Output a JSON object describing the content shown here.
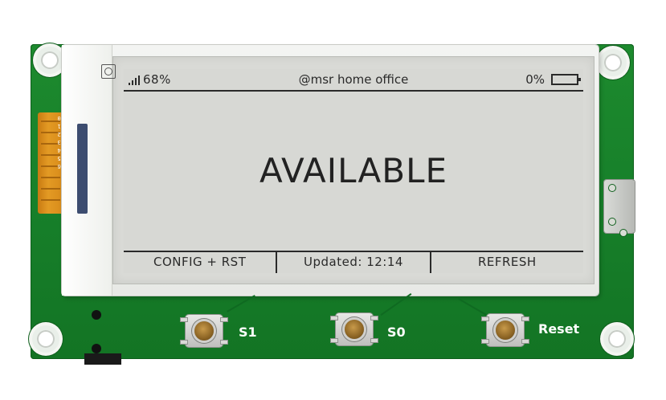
{
  "device": {
    "status_bar": {
      "signal_text": "68%",
      "location": "@msr home office",
      "battery_text": "0%"
    },
    "main_status": "AVAILABLE",
    "button_bar": [
      "CONFIG + RST",
      "Updated: 12:14",
      "REFRESH"
    ],
    "hardware_buttons": {
      "s1_label": "S1",
      "s0_label": "S0",
      "reset_label": "Reset"
    },
    "flex_labels": [
      "P0",
      "P1",
      "P2",
      "P3",
      "P4",
      "P5",
      "P6"
    ]
  },
  "colors": {
    "pcb_green": "#1d8a2e",
    "epaper_background": "#d7d8d4",
    "epaper_ink": "#2a2a2a",
    "flex_cable": "#e39a24",
    "button_cap": "#8c6424"
  }
}
